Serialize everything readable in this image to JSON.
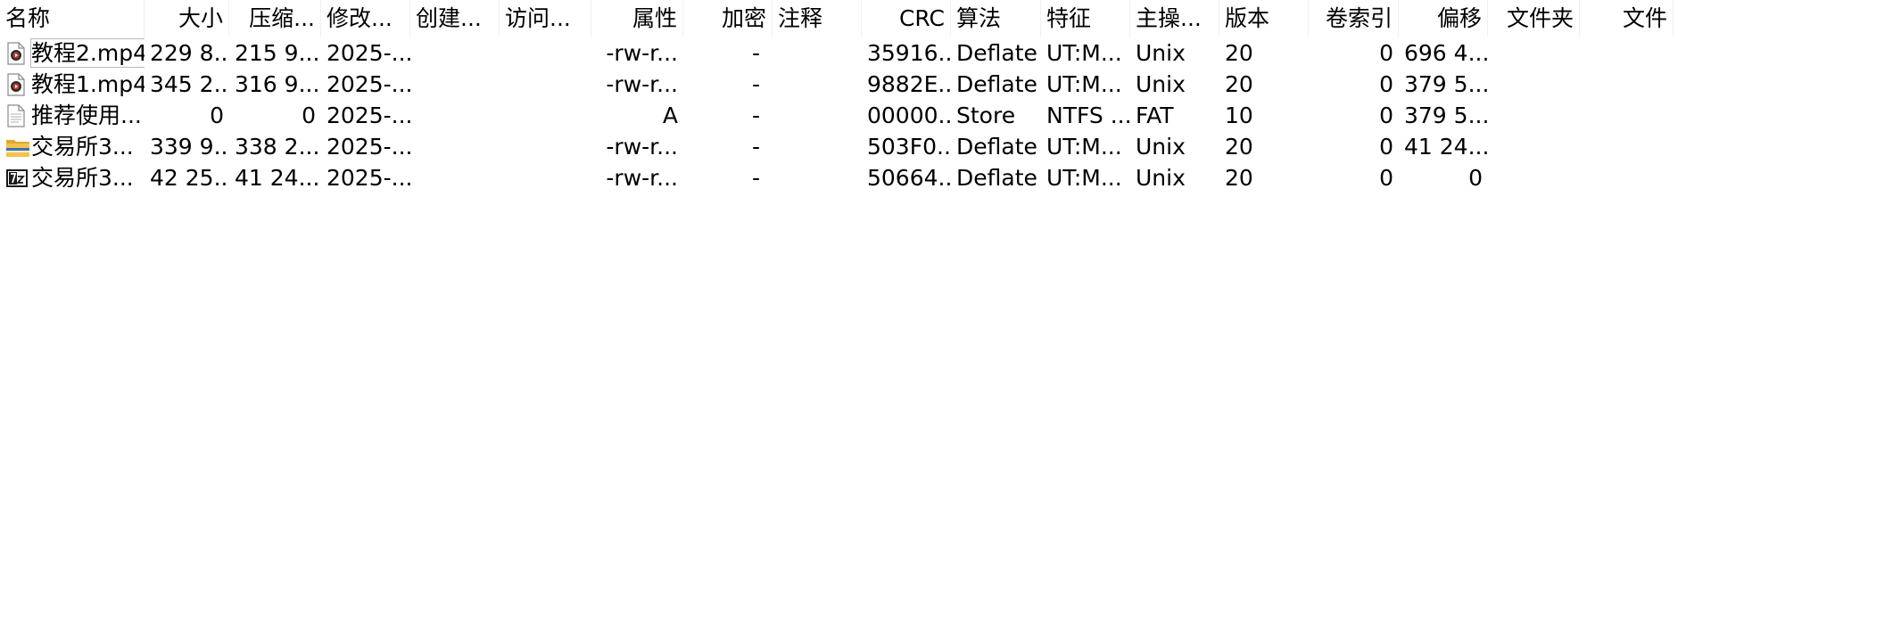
{
  "columns": [
    {
      "key": "name",
      "label": "名称"
    },
    {
      "key": "size",
      "label": "大小"
    },
    {
      "key": "packed",
      "label": "压缩..."
    },
    {
      "key": "modified",
      "label": "修改..."
    },
    {
      "key": "created",
      "label": "创建..."
    },
    {
      "key": "accessed",
      "label": "访问..."
    },
    {
      "key": "attributes",
      "label": "属性"
    },
    {
      "key": "encrypted",
      "label": "加密"
    },
    {
      "key": "comment",
      "label": "注释"
    },
    {
      "key": "crc",
      "label": "CRC"
    },
    {
      "key": "method",
      "label": "算法"
    },
    {
      "key": "characteristics",
      "label": "特征"
    },
    {
      "key": "host_os",
      "label": "主操..."
    },
    {
      "key": "version",
      "label": "版本"
    },
    {
      "key": "volume_index",
      "label": "卷索引"
    },
    {
      "key": "offset",
      "label": "偏移"
    },
    {
      "key": "folders",
      "label": "文件夹"
    },
    {
      "key": "files",
      "label": "文件"
    }
  ],
  "rows": [
    {
      "icon": "video-file-icon",
      "name": "教程2.mp4",
      "size": "229 8...",
      "packed": "215 9...",
      "modified": "2025-...",
      "created": "",
      "accessed": "",
      "attributes": "-rw-r...",
      "encrypted": "-",
      "comment": "",
      "crc": "35916...",
      "method": "Deflate",
      "characteristics": "UT:M...",
      "host_os": "Unix",
      "version": "20",
      "volume_index": "0",
      "offset": "696 4...",
      "folders": "",
      "files": ""
    },
    {
      "icon": "video-file-icon",
      "name": "教程1.mp4",
      "size": "345 2...",
      "packed": "316 9...",
      "modified": "2025-...",
      "created": "",
      "accessed": "",
      "attributes": "-rw-r...",
      "encrypted": "-",
      "comment": "",
      "crc": "9882E...",
      "method": "Deflate",
      "characteristics": "UT:M...",
      "host_os": "Unix",
      "version": "20",
      "volume_index": "0",
      "offset": "379 5...",
      "folders": "",
      "files": ""
    },
    {
      "icon": "text-file-icon",
      "name": "推荐使用...",
      "size": "0",
      "packed": "0",
      "modified": "2025-...",
      "created": "",
      "accessed": "",
      "attributes": "A",
      "encrypted": "-",
      "comment": "",
      "crc": "00000...",
      "method": "Store",
      "characteristics": "NTFS ...",
      "host_os": "FAT",
      "version": "10",
      "volume_index": "0",
      "offset": "379 5...",
      "folders": "",
      "files": ""
    },
    {
      "icon": "zip-archive-icon",
      "name": "交易所3...",
      "size": "339 9...",
      "packed": "338 2...",
      "modified": "2025-...",
      "created": "",
      "accessed": "",
      "attributes": "-rw-r...",
      "encrypted": "-",
      "comment": "",
      "crc": "503F0...",
      "method": "Deflate",
      "characteristics": "UT:M...",
      "host_os": "Unix",
      "version": "20",
      "volume_index": "0",
      "offset": "41 24...",
      "folders": "",
      "files": ""
    },
    {
      "icon": "7z-archive-icon",
      "name": "交易所3...",
      "size": "42 25...",
      "packed": "41 24...",
      "modified": "2025-...",
      "created": "",
      "accessed": "",
      "attributes": "-rw-r...",
      "encrypted": "-",
      "comment": "",
      "crc": "50664...",
      "method": "Deflate",
      "characteristics": "UT:M...",
      "host_os": "Unix",
      "version": "20",
      "volume_index": "0",
      "offset": "0",
      "folders": "",
      "files": ""
    }
  ],
  "focused_row": 0,
  "colors": {
    "background": "#ffffff",
    "text": "#000000",
    "header_divider": "#f0f0f0",
    "focus_outline": "#b9b9b9",
    "zip_folder_yellow": "#f2c24a",
    "7z_icon_black": "#1a1a1a",
    "video_icon_red": "#c0392b"
  }
}
